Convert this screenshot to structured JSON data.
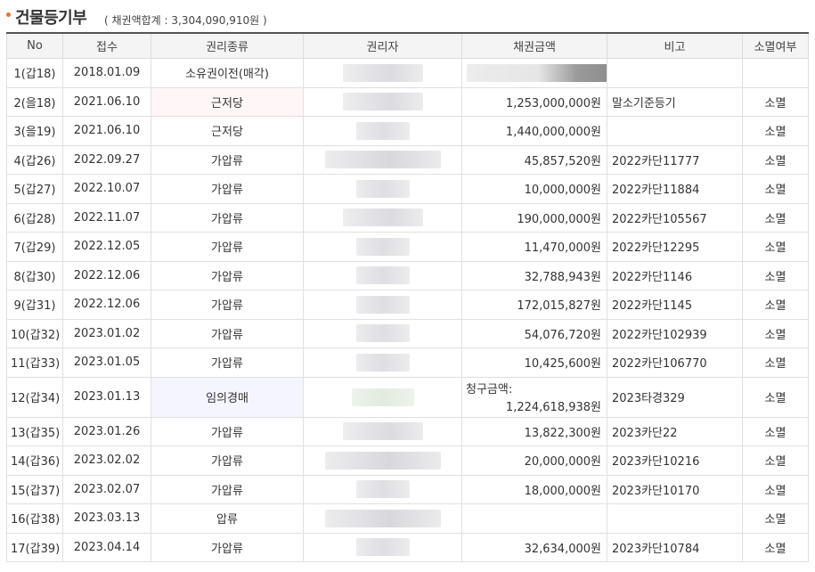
{
  "header": {
    "title": "건물등기부",
    "subtitle": "( 채권액합계 : 3,304,090,910원 )"
  },
  "columns": [
    "No",
    "접수",
    "권리종류",
    "권리자",
    "채권금액",
    "비고",
    "소멸여부"
  ],
  "rows": [
    {
      "no": "1(갑18)",
      "date": "2018.01.09",
      "type": "소유권이전(매각)",
      "amount": "",
      "note": "",
      "status": ""
    },
    {
      "no": "2(을18)",
      "date": "2021.06.10",
      "type": "근저당",
      "amount": "1,253,000,000원",
      "note": "말소기준등기",
      "status": "소멸"
    },
    {
      "no": "3(을19)",
      "date": "2021.06.10",
      "type": "근저당",
      "amount": "1,440,000,000원",
      "note": "",
      "status": "소멸"
    },
    {
      "no": "4(갑26)",
      "date": "2022.09.27",
      "type": "가압류",
      "amount": "45,857,520원",
      "note": "2022카단11777",
      "status": "소멸"
    },
    {
      "no": "5(갑27)",
      "date": "2022.10.07",
      "type": "가압류",
      "amount": "10,000,000원",
      "note": "2022카단11884",
      "status": "소멸"
    },
    {
      "no": "6(갑28)",
      "date": "2022.11.07",
      "type": "가압류",
      "amount": "190,000,000원",
      "note": "2022카단105567",
      "status": "소멸"
    },
    {
      "no": "7(갑29)",
      "date": "2022.12.05",
      "type": "가압류",
      "amount": "11,470,000원",
      "note": "2022카단12295",
      "status": "소멸"
    },
    {
      "no": "8(갑30)",
      "date": "2022.12.06",
      "type": "가압류",
      "amount": "32,788,943원",
      "note": "2022카단1146",
      "status": "소멸"
    },
    {
      "no": "9(갑31)",
      "date": "2022.12.06",
      "type": "가압류",
      "amount": "172,015,827원",
      "note": "2022카단1145",
      "status": "소멸"
    },
    {
      "no": "10(갑32)",
      "date": "2023.01.02",
      "type": "가압류",
      "amount": "54,076,720원",
      "note": "2022카단102939",
      "status": "소멸"
    },
    {
      "no": "11(갑33)",
      "date": "2023.01.05",
      "type": "가압류",
      "amount": "10,425,600원",
      "note": "2022카단106770",
      "status": "소멸"
    },
    {
      "no": "12(갑34)",
      "date": "2023.01.13",
      "type": "임의경매",
      "amount_label": "청구금액:",
      "amount": "1,224,618,938원",
      "note": "2023타경329",
      "status": "소멸"
    },
    {
      "no": "13(갑35)",
      "date": "2023.01.26",
      "type": "가압류",
      "amount": "13,822,300원",
      "note": "2023카단22",
      "status": "소멸"
    },
    {
      "no": "14(갑36)",
      "date": "2023.02.02",
      "type": "가압류",
      "amount": "20,000,000원",
      "note": "2023카단10216",
      "status": "소멸"
    },
    {
      "no": "15(갑37)",
      "date": "2023.02.07",
      "type": "가압류",
      "amount": "18,000,000원",
      "note": "2023카단10170",
      "status": "소멸"
    },
    {
      "no": "16(갑38)",
      "date": "2023.03.13",
      "type": "압류",
      "amount": "",
      "note": "",
      "status": "소멸"
    },
    {
      "no": "17(갑39)",
      "date": "2023.04.14",
      "type": "가압류",
      "amount": "32,634,000원",
      "note": "2023카단10784",
      "status": "소멸"
    }
  ],
  "colors": {
    "bullet": "#e8762b",
    "header_border": "#555555",
    "pink_cell": "#fff6f7",
    "lavender_cell": "#f5f5ff"
  }
}
